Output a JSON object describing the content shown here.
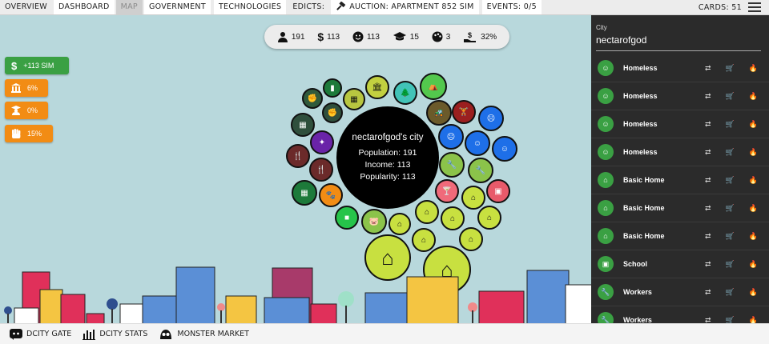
{
  "topbar": {
    "overview": "OVERVIEW",
    "dashboard": "DASHBOARD",
    "map": "MAP",
    "government": "GOVERNMENT",
    "technologies": "TECHNOLOGIES",
    "edicts": "EDICTS:",
    "auction": "AUCTION: APARTMENT 852 SIM",
    "events": "EVENTS: 0/5",
    "cards": "CARDS: 51"
  },
  "stats": {
    "population": "191",
    "income": "113",
    "popularity": "113",
    "education": "15",
    "culture": "3",
    "tax": "32%"
  },
  "badges": {
    "sim": "+113 SIM",
    "b1": "6%",
    "b2": "0%",
    "b3": "15%"
  },
  "city_center": {
    "title": "nectarofgod's city",
    "population": "Population: 191",
    "income": "Income: 113",
    "popularity": "Popularity: 113"
  },
  "panel": {
    "label": "City",
    "city_name": "nectarofgod",
    "rows": [
      {
        "name": "Homeless"
      },
      {
        "name": "Homeless"
      },
      {
        "name": "Homeless"
      },
      {
        "name": "Homeless"
      },
      {
        "name": "Basic Home"
      },
      {
        "name": "Basic Home"
      },
      {
        "name": "Basic Home"
      },
      {
        "name": "School"
      },
      {
        "name": "Workers"
      },
      {
        "name": "Workers"
      }
    ]
  },
  "bottombar": {
    "gate": "DCITY GATE",
    "stats": "DCITY STATS",
    "market": "MONSTER MARKET"
  },
  "colors": {
    "green": "#3aa043",
    "orange": "#f28c14",
    "panel": "#2b2b2b",
    "sky": "#b8d8dc"
  }
}
